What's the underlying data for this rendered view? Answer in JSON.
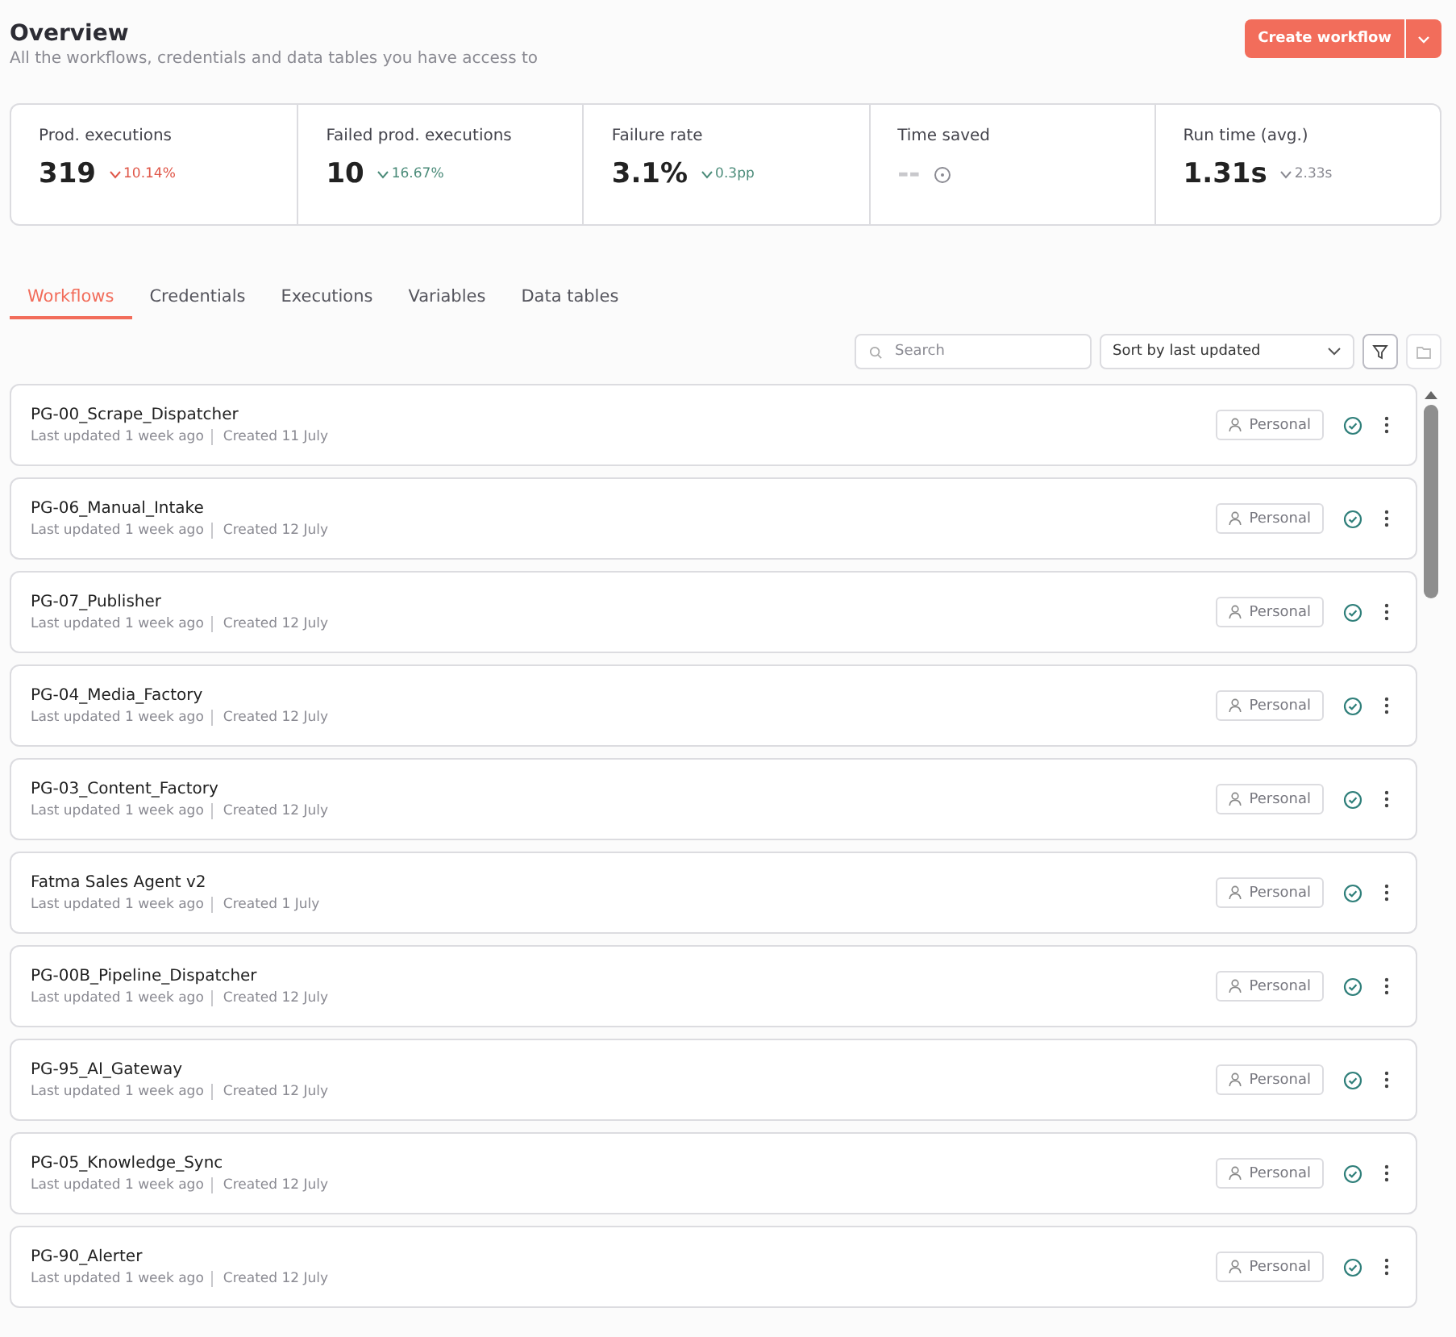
{
  "header": {
    "title": "Overview",
    "subtitle": "All the workflows, credentials and data tables you have access to",
    "create_button": "Create workflow"
  },
  "stats": [
    {
      "label": "Prod. executions",
      "value": "319",
      "change": "10.14%",
      "color": "#e0584a"
    },
    {
      "label": "Failed prod. executions",
      "value": "10",
      "change": "16.67%",
      "color": "#4c8c7a"
    },
    {
      "label": "Failure rate",
      "value": "3.1%",
      "change": "0.3pp",
      "color": "#4c8c7a"
    },
    {
      "label": "Time saved",
      "value": "--"
    },
    {
      "label": "Run time (avg.)",
      "value": "1.31s",
      "change": "2.33s",
      "color": "#8a8a92"
    }
  ],
  "tabs": [
    {
      "label": "Workflows",
      "selected": true
    },
    {
      "label": "Credentials",
      "selected": false
    },
    {
      "label": "Executions",
      "selected": false
    },
    {
      "label": "Variables",
      "selected": false
    },
    {
      "label": "Data tables",
      "selected": false
    }
  ],
  "toolbar": {
    "search_placeholder": "Search",
    "sort": "Sort by last updated"
  },
  "workflows": [
    {
      "name": "PG-00_Scrape_Dispatcher",
      "updated": "Last updated 1 week ago",
      "created": "Created 11 July",
      "owner": "Personal",
      "active": true
    },
    {
      "name": "PG-06_Manual_Intake",
      "updated": "Last updated 1 week ago",
      "created": "Created 12 July",
      "owner": "Personal",
      "active": true
    },
    {
      "name": "PG-07_Publisher",
      "updated": "Last updated 1 week ago",
      "created": "Created 12 July",
      "owner": "Personal",
      "active": true
    },
    {
      "name": "PG-04_Media_Factory",
      "updated": "Last updated 1 week ago",
      "created": "Created 12 July",
      "owner": "Personal",
      "active": true
    },
    {
      "name": "PG-03_Content_Factory",
      "updated": "Last updated 1 week ago",
      "created": "Created 12 July",
      "owner": "Personal",
      "active": true
    },
    {
      "name": "Fatma Sales Agent v2",
      "updated": "Last updated 1 week ago",
      "created": "Created 1 July",
      "owner": "Personal",
      "active": true
    },
    {
      "name": "PG-00B_Pipeline_Dispatcher",
      "updated": "Last updated 1 week ago",
      "created": "Created 12 July",
      "owner": "Personal",
      "active": true
    },
    {
      "name": "PG-95_AI_Gateway",
      "updated": "Last updated 1 week ago",
      "created": "Created 12 July",
      "owner": "Personal",
      "active": true
    },
    {
      "name": "PG-05_Knowledge_Sync",
      "updated": "Last updated 1 week ago",
      "created": "Created 12 July",
      "owner": "Personal",
      "active": true
    },
    {
      "name": "PG-90_Alerter",
      "updated": "Last updated 1 week ago",
      "created": "Created 12 July",
      "owner": "Personal",
      "active": true
    }
  ]
}
